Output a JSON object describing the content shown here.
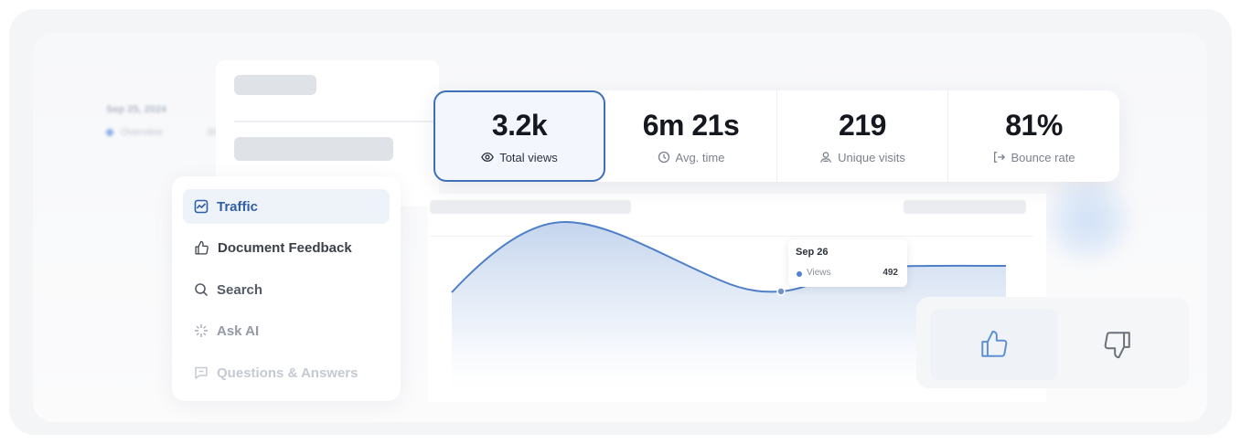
{
  "background": {
    "date": "Sep 25, 2024",
    "legend_label": "Overview",
    "legend_extra": "30"
  },
  "stats": [
    {
      "value": "3.2k",
      "label": "Total views",
      "icon": "eye-icon",
      "selected": true
    },
    {
      "value": "6m 21s",
      "label": "Avg. time",
      "icon": "clock-icon",
      "selected": false
    },
    {
      "value": "219",
      "label": "Unique visits",
      "icon": "user-icon",
      "selected": false
    },
    {
      "value": "81%",
      "label": "Bounce rate",
      "icon": "exit-icon",
      "selected": false
    }
  ],
  "menu": {
    "items": [
      {
        "label": "Traffic",
        "icon": "traffic-chart-icon",
        "active": true
      },
      {
        "label": "Document Feedback",
        "icon": "thumbs-up-icon",
        "active": false
      },
      {
        "label": "Search",
        "icon": "search-icon",
        "active": false
      },
      {
        "label": "Ask AI",
        "icon": "sparkle-icon",
        "active": false
      },
      {
        "label": "Questions & Answers",
        "icon": "chat-icon",
        "active": false
      }
    ]
  },
  "tooltip": {
    "date": "Sep 26",
    "series": "Views",
    "value": "492"
  },
  "feedback": {
    "up_icon": "thumbs-up-icon",
    "down_icon": "thumbs-down-icon"
  },
  "colors": {
    "accent": "#3f6fb6",
    "line": "#4f7fc6",
    "active_bg": "#eef3fa"
  }
}
